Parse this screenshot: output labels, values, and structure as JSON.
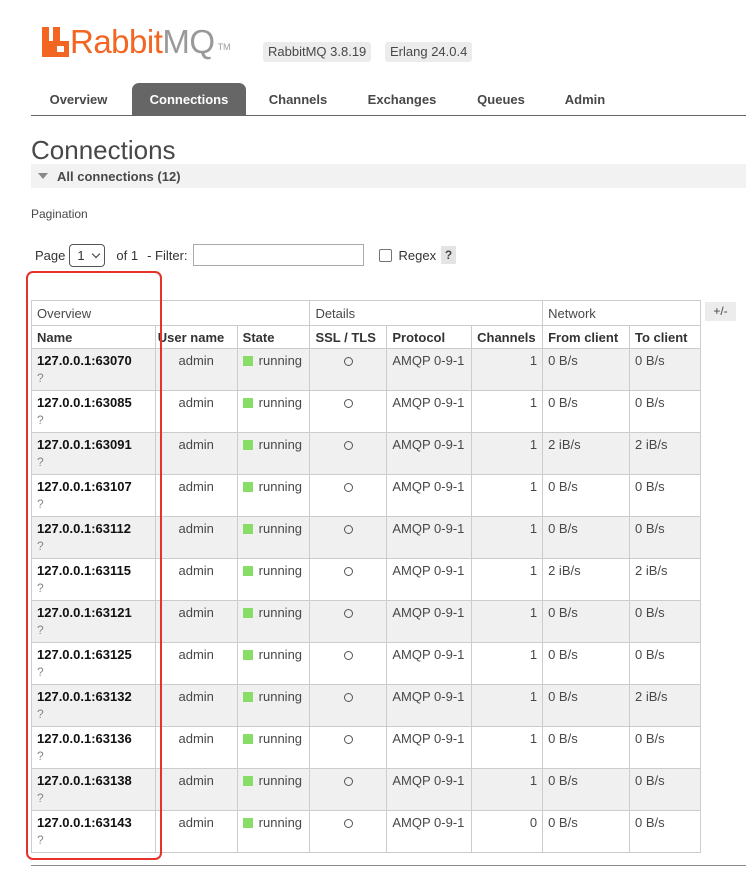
{
  "logo": {
    "word_rabbit": "Rabbit",
    "word_mq": "MQ",
    "tm": "TM"
  },
  "versions": {
    "rabbitmq": "RabbitMQ 3.8.19",
    "erlang": "Erlang 24.0.4"
  },
  "tabs": [
    {
      "label": "Overview",
      "active": false
    },
    {
      "label": "Connections",
      "active": true
    },
    {
      "label": "Channels",
      "active": false
    },
    {
      "label": "Exchanges",
      "active": false
    },
    {
      "label": "Queues",
      "active": false
    },
    {
      "label": "Admin",
      "active": false
    }
  ],
  "page_title": "Connections",
  "section_header": "All connections (12)",
  "pagination": {
    "label": "Pagination",
    "page_label": "Page",
    "page_value": "1",
    "of_label": "of 1",
    "filter_label": "- Filter:",
    "filter_value": "",
    "regex_label": "Regex",
    "regex_checked": false,
    "help": "?"
  },
  "table": {
    "groups": {
      "overview": "Overview",
      "details": "Details",
      "network": "Network"
    },
    "columns": {
      "name": "Name",
      "user": "User name",
      "state": "State",
      "ssl": "SSL / TLS",
      "protocol": "Protocol",
      "channels": "Channels",
      "from_client": "From client",
      "to_client": "To client"
    },
    "toggle_columns": "+/-",
    "rows": [
      {
        "name": "127.0.0.1:63070",
        "q": "?",
        "user": "admin",
        "state": "running",
        "protocol": "AMQP 0-9-1",
        "channels": "1",
        "from_client": "0 B/s",
        "to_client": "0 B/s"
      },
      {
        "name": "127.0.0.1:63085",
        "q": "?",
        "user": "admin",
        "state": "running",
        "protocol": "AMQP 0-9-1",
        "channels": "1",
        "from_client": "0 B/s",
        "to_client": "0 B/s"
      },
      {
        "name": "127.0.0.1:63091",
        "q": "?",
        "user": "admin",
        "state": "running",
        "protocol": "AMQP 0-9-1",
        "channels": "1",
        "from_client": "2 iB/s",
        "to_client": "2 iB/s"
      },
      {
        "name": "127.0.0.1:63107",
        "q": "?",
        "user": "admin",
        "state": "running",
        "protocol": "AMQP 0-9-1",
        "channels": "1",
        "from_client": "0 B/s",
        "to_client": "0 B/s"
      },
      {
        "name": "127.0.0.1:63112",
        "q": "?",
        "user": "admin",
        "state": "running",
        "protocol": "AMQP 0-9-1",
        "channels": "1",
        "from_client": "0 B/s",
        "to_client": "0 B/s"
      },
      {
        "name": "127.0.0.1:63115",
        "q": "?",
        "user": "admin",
        "state": "running",
        "protocol": "AMQP 0-9-1",
        "channels": "1",
        "from_client": "2 iB/s",
        "to_client": "2 iB/s"
      },
      {
        "name": "127.0.0.1:63121",
        "q": "?",
        "user": "admin",
        "state": "running",
        "protocol": "AMQP 0-9-1",
        "channels": "1",
        "from_client": "0 B/s",
        "to_client": "0 B/s"
      },
      {
        "name": "127.0.0.1:63125",
        "q": "?",
        "user": "admin",
        "state": "running",
        "protocol": "AMQP 0-9-1",
        "channels": "1",
        "from_client": "0 B/s",
        "to_client": "0 B/s"
      },
      {
        "name": "127.0.0.1:63132",
        "q": "?",
        "user": "admin",
        "state": "running",
        "protocol": "AMQP 0-9-1",
        "channels": "1",
        "from_client": "0 B/s",
        "to_client": "2 iB/s"
      },
      {
        "name": "127.0.0.1:63136",
        "q": "?",
        "user": "admin",
        "state": "running",
        "protocol": "AMQP 0-9-1",
        "channels": "1",
        "from_client": "0 B/s",
        "to_client": "0 B/s"
      },
      {
        "name": "127.0.0.1:63138",
        "q": "?",
        "user": "admin",
        "state": "running",
        "protocol": "AMQP 0-9-1",
        "channels": "1",
        "from_client": "0 B/s",
        "to_client": "0 B/s"
      },
      {
        "name": "127.0.0.1:63143",
        "q": "?",
        "user": "admin",
        "state": "running",
        "protocol": "AMQP 0-9-1",
        "channels": "0",
        "from_client": "0 B/s",
        "to_client": "0 B/s"
      }
    ]
  },
  "colors": {
    "brand_orange": "#f26622",
    "tab_active_bg": "#666666",
    "state_running": "#88dd66",
    "highlight": "#e5332a"
  },
  "icons": {
    "collapse": "triangle-down-icon",
    "page_select": "chevron-down-icon",
    "state": "state-square-icon",
    "ssl": "ssl-circle-icon"
  }
}
